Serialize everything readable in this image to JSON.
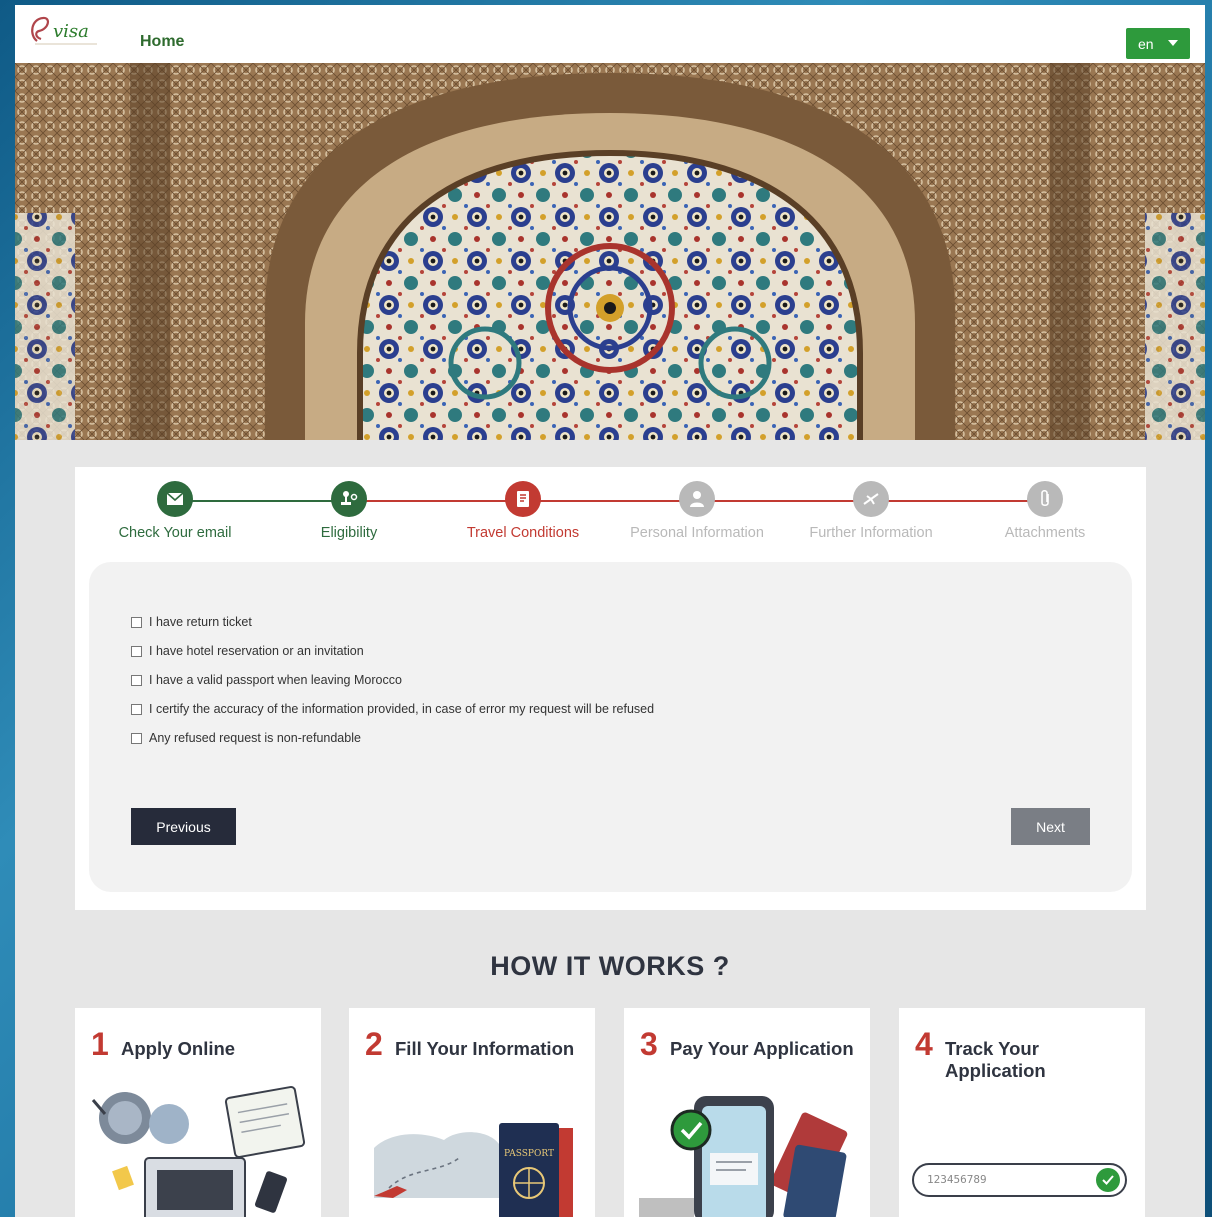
{
  "header": {
    "logo_text": "evisa",
    "home_label": "Home",
    "language": "en"
  },
  "steps": [
    {
      "label": "Check Your email",
      "state": "done",
      "icon": "envelope-icon"
    },
    {
      "label": "Eligibility",
      "state": "done",
      "icon": "stamp-icon"
    },
    {
      "label": "Travel Conditions",
      "state": "current",
      "icon": "document-icon"
    },
    {
      "label": "Personal Information",
      "state": "pending",
      "icon": "user-icon"
    },
    {
      "label": "Further Information",
      "state": "pending",
      "icon": "airplane-icon"
    },
    {
      "label": "Attachments",
      "state": "pending",
      "icon": "paperclip-icon"
    }
  ],
  "colors": {
    "done": "#2e6b3e",
    "current": "#c23a32",
    "pending": "#b9b9b9",
    "accent_green": "#2e9a3c",
    "dark_button": "#262b3a"
  },
  "conditions": [
    "I have return ticket",
    "I have hotel reservation or an invitation",
    "I have a valid passport when leaving Morocco",
    "I certify the accuracy of the information provided, in case of error my request will be refused",
    "Any refused request is non-refundable"
  ],
  "buttons": {
    "previous": "Previous",
    "next": "Next"
  },
  "how_it_works": {
    "title": "HOW IT WORKS ?",
    "cards": [
      {
        "number": "1",
        "title": "Apply Online"
      },
      {
        "number": "2",
        "title": "Fill Your Information"
      },
      {
        "number": "3",
        "title": "Pay Your Application"
      },
      {
        "number": "4",
        "title": "Track Your Application"
      }
    ],
    "passport_text": "PASSPORT",
    "track_placeholder": "123456789"
  }
}
